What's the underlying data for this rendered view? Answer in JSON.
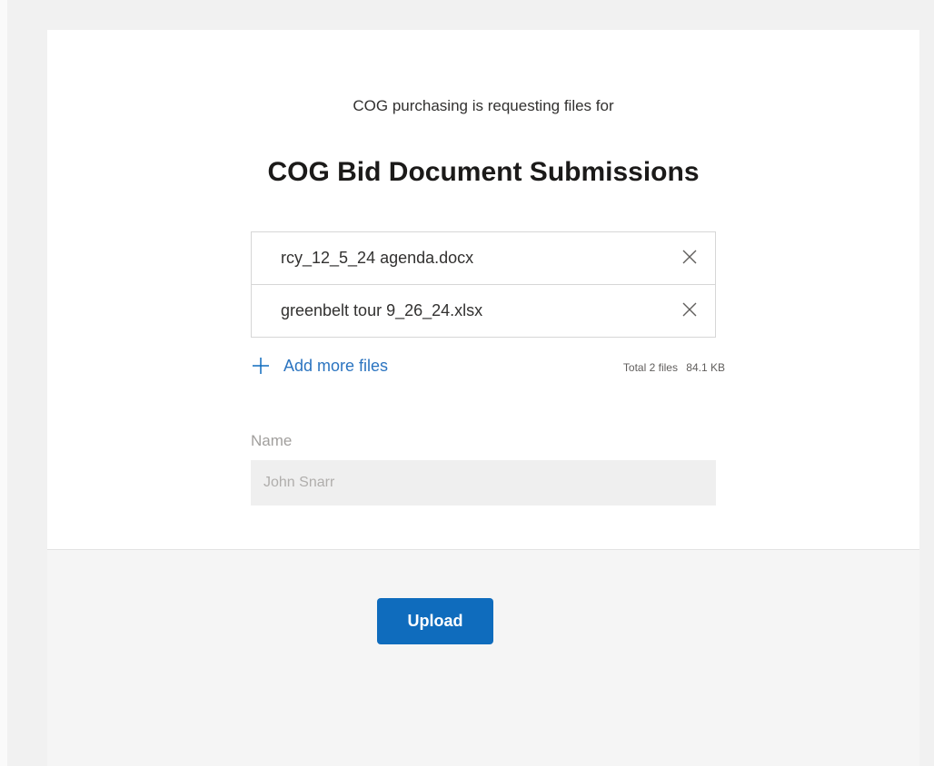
{
  "request": {
    "requester_text": "COG purchasing is requesting files for",
    "title": "COG Bid Document Submissions"
  },
  "files": [
    {
      "name": "rcy_12_5_24 agenda.docx",
      "remove_icon": "close-icon"
    },
    {
      "name": "greenbelt tour 9_26_24.xlsx",
      "remove_icon": "close-icon"
    }
  ],
  "add_more": {
    "icon": "plus-icon",
    "label": "Add more files"
  },
  "summary": {
    "total_label": "Total 2 files",
    "total_size": "84.1 KB"
  },
  "name_field": {
    "label": "Name",
    "value": "",
    "placeholder": "John Snarr"
  },
  "actions": {
    "upload_label": "Upload"
  },
  "colors": {
    "accent": "#0f6cbd",
    "link": "#2b74c0",
    "page_background": "#f1f1f1",
    "card_background": "#ffffff",
    "footer_background": "#f5f5f5",
    "input_background": "#efefef"
  }
}
